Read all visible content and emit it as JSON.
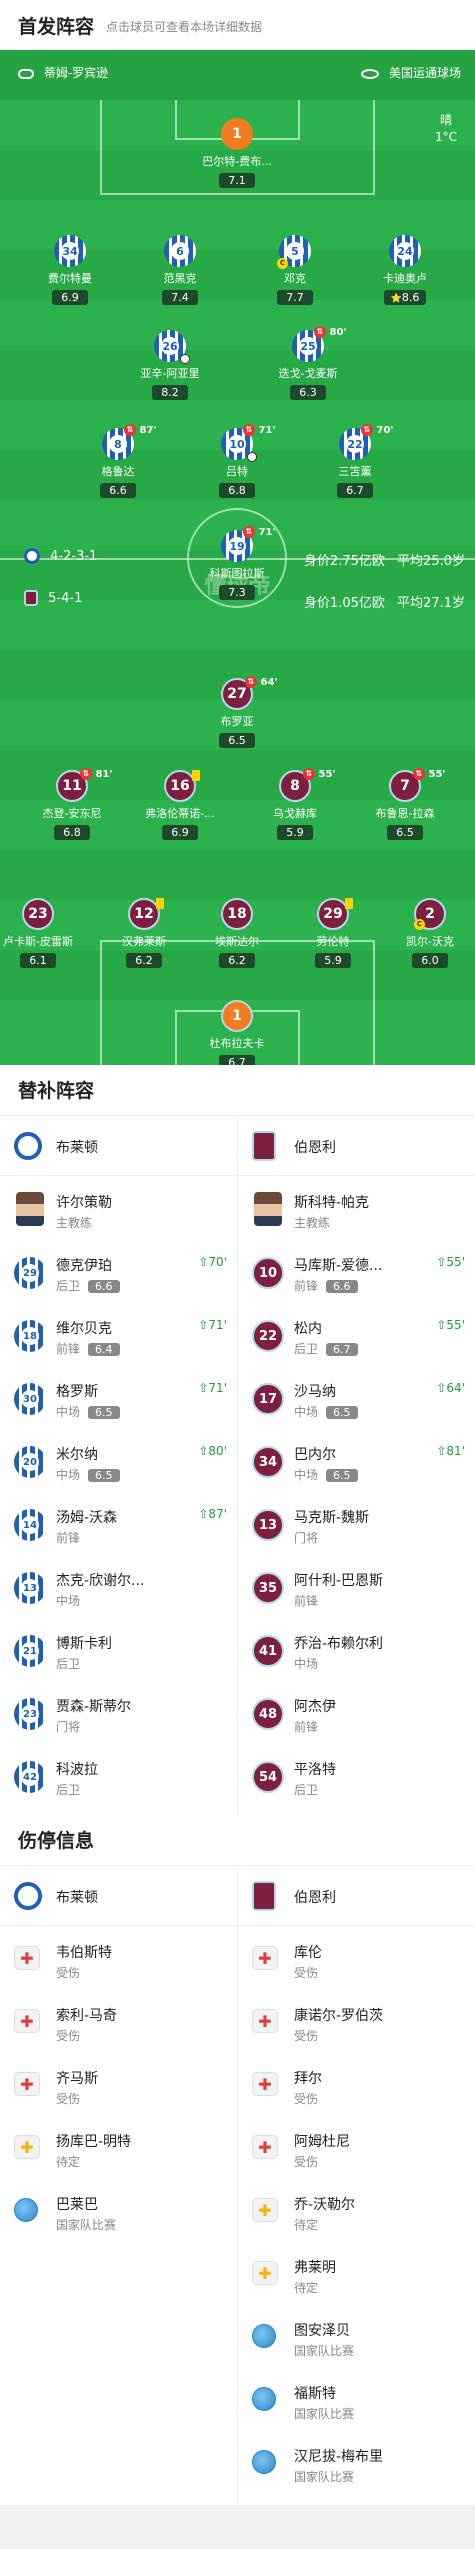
{
  "header": {
    "title": "首发阵容",
    "subtitle": "点击球员可查看本场详细数据"
  },
  "venue": {
    "coach": "蒂姆-罗宾逊",
    "stadium": "美国运通球场",
    "weather": "晴",
    "temp": "1°C"
  },
  "formation": {
    "home": {
      "shape": "4-2-3-1",
      "value": "身价2.75亿欧",
      "age": "平均25.0岁"
    },
    "away": {
      "shape": "5-4-1",
      "value": "身价1.05亿欧",
      "age": "平均27.1岁"
    },
    "watermark": "懂球帝"
  },
  "home_players": [
    {
      "num": "1",
      "name": "巴尔特-费布...",
      "rating": "7.1",
      "gk": true
    },
    {
      "num": "34",
      "name": "费尔特曼",
      "rating": "6.9"
    },
    {
      "num": "6",
      "name": "范黑克",
      "rating": "7.4"
    },
    {
      "num": "5",
      "name": "邓克",
      "rating": "7.7",
      "cap": "C"
    },
    {
      "num": "24",
      "name": "卡迪奥卢",
      "rating": "8.6",
      "star": "⭐"
    },
    {
      "num": "26",
      "name": "亚辛-阿亚里",
      "rating": "8.2",
      "ball": true
    },
    {
      "num": "25",
      "name": "迭戈-戈麦斯",
      "rating": "6.3",
      "sub": "80'"
    },
    {
      "num": "8",
      "name": "格鲁达",
      "rating": "6.6",
      "sub": "87'"
    },
    {
      "num": "10",
      "name": "吕特",
      "rating": "6.8",
      "sub": "71'",
      "ball": true
    },
    {
      "num": "22",
      "name": "三笘薰",
      "rating": "6.7",
      "sub": "70'"
    },
    {
      "num": "19",
      "name": "科斯图拉斯",
      "rating": "7.3",
      "sub": "71'"
    }
  ],
  "away_players": [
    {
      "num": "27",
      "name": "布罗亚",
      "rating": "6.5",
      "sub": "64'"
    },
    {
      "num": "11",
      "name": "杰登-安东尼",
      "rating": "6.8",
      "sub": "81'"
    },
    {
      "num": "16",
      "name": "弗洛伦蒂诺-...",
      "rating": "6.9",
      "card": true
    },
    {
      "num": "8",
      "name": "乌戈赫库",
      "rating": "5.9",
      "sub": "55'"
    },
    {
      "num": "7",
      "name": "布鲁恩-拉森",
      "rating": "6.5",
      "sub": "55'"
    },
    {
      "num": "23",
      "name": "卢卡斯-皮雷斯",
      "rating": "6.1"
    },
    {
      "num": "12",
      "name": "汉弗莱斯",
      "rating": "6.2",
      "card": true
    },
    {
      "num": "18",
      "name": "埃斯达尔",
      "rating": "6.2"
    },
    {
      "num": "29",
      "name": "劳伦特",
      "rating": "5.9",
      "card": true
    },
    {
      "num": "2",
      "name": "凯尔-沃克",
      "rating": "6.0",
      "cap": "C"
    },
    {
      "num": "1",
      "name": "杜布拉夫卡",
      "rating": "6.7",
      "gk": true
    }
  ],
  "subs": {
    "title": "替补阵容",
    "home_team": "布莱顿",
    "away_team": "伯恩利",
    "home": [
      {
        "name": "许尔策勒",
        "pos": "主教练",
        "coach": true
      },
      {
        "num": "29",
        "name": "德克伊珀",
        "pos": "后卫",
        "rating": "6.6",
        "time": "70'"
      },
      {
        "num": "18",
        "name": "维尔贝克",
        "pos": "前锋",
        "rating": "6.4",
        "time": "71'"
      },
      {
        "num": "30",
        "name": "格罗斯",
        "pos": "中场",
        "rating": "6.5",
        "time": "71'"
      },
      {
        "num": "20",
        "name": "米尔纳",
        "pos": "中场",
        "rating": "6.5",
        "time": "80'"
      },
      {
        "num": "14",
        "name": "汤姆-沃森",
        "pos": "前锋",
        "time": "87'"
      },
      {
        "num": "13",
        "name": "杰克-欣谢尔...",
        "pos": "中场"
      },
      {
        "num": "21",
        "name": "博斯卡利",
        "pos": "后卫"
      },
      {
        "num": "23",
        "name": "贾森-斯蒂尔",
        "pos": "门将"
      },
      {
        "num": "42",
        "name": "科波拉",
        "pos": "后卫"
      }
    ],
    "away": [
      {
        "name": "斯科特-帕克",
        "pos": "主教练",
        "coach": true
      },
      {
        "num": "10",
        "name": "马库斯-爱德...",
        "pos": "前锋",
        "rating": "6.6",
        "time": "55'"
      },
      {
        "num": "22",
        "name": "松内",
        "pos": "后卫",
        "rating": "6.7",
        "time": "55'"
      },
      {
        "num": "17",
        "name": "沙马纳",
        "pos": "中场",
        "rating": "6.5",
        "time": "64'"
      },
      {
        "num": "34",
        "name": "巴内尔",
        "pos": "中场",
        "rating": "6.5",
        "time": "81'"
      },
      {
        "num": "13",
        "name": "马克斯-魏斯",
        "pos": "门将"
      },
      {
        "num": "35",
        "name": "阿什利-巴恩斯",
        "pos": "前锋"
      },
      {
        "num": "41",
        "name": "乔治-布赖尔利",
        "pos": "中场"
      },
      {
        "num": "48",
        "name": "阿杰伊",
        "pos": "前锋"
      },
      {
        "num": "54",
        "name": "平洛特",
        "pos": "后卫"
      }
    ]
  },
  "injuries": {
    "title": "伤停信息",
    "home_team": "布莱顿",
    "away_team": "伯恩利",
    "home": [
      {
        "name": "韦伯斯特",
        "status": "受伤",
        "kind": "red"
      },
      {
        "name": "索利-马奇",
        "status": "受伤",
        "kind": "red"
      },
      {
        "name": "齐马斯",
        "status": "受伤",
        "kind": "red"
      },
      {
        "name": "扬库巴-明特",
        "status": "待定",
        "kind": "yellow"
      },
      {
        "name": "巴莱巴",
        "status": "国家队比赛",
        "kind": "globe"
      }
    ],
    "away": [
      {
        "name": "库伦",
        "status": "受伤",
        "kind": "red"
      },
      {
        "name": "康诺尔-罗伯茨",
        "status": "受伤",
        "kind": "red"
      },
      {
        "name": "拜尔",
        "status": "受伤",
        "kind": "red"
      },
      {
        "name": "阿姆杜尼",
        "status": "受伤",
        "kind": "red"
      },
      {
        "name": "乔-沃勒尔",
        "status": "待定",
        "kind": "yellow"
      },
      {
        "name": "弗莱明",
        "status": "待定",
        "kind": "yellow"
      },
      {
        "name": "图安泽贝",
        "status": "国家队比赛",
        "kind": "globe"
      },
      {
        "name": "福斯特",
        "status": "国家队比赛",
        "kind": "globe"
      },
      {
        "name": "汉尼拔-梅布里",
        "status": "国家队比赛",
        "kind": "globe"
      }
    ]
  },
  "colors": {
    "pitch": "#2bb24c",
    "home": "#1f5fb8",
    "away": "#7d2040",
    "sub_green": "#1d9e3c"
  }
}
